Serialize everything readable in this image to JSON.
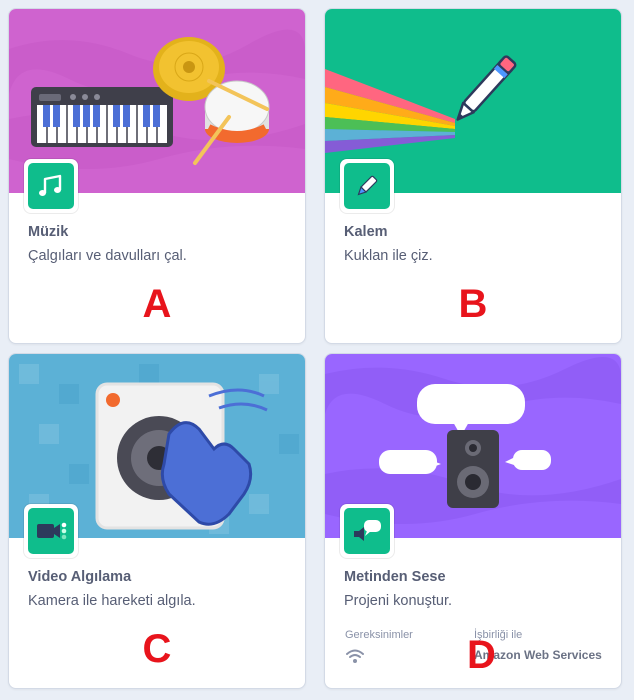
{
  "cards": [
    {
      "title": "Müzik",
      "description": "Çalgıları ve davulları çal.",
      "letter": "A",
      "badge_icon": "music-notes-icon",
      "art_color": "#cf63cf"
    },
    {
      "title": "Kalem",
      "description": "Kuklan ile çiz.",
      "letter": "B",
      "badge_icon": "pen-icon",
      "art_color": "#0fbd8c"
    },
    {
      "title": "Video Algılama",
      "description": "Kamera ile hareketi algıla.",
      "letter": "C",
      "badge_icon": "video-sensing-icon",
      "art_color": "#5cb1d6"
    },
    {
      "title": "Metinden Sese",
      "description": "Projeni konuştur.",
      "letter": "D",
      "badge_icon": "speech-bubble-icon",
      "art_color": "#9966ff",
      "requirements_label": "Gereksinimler",
      "requirements_icon": "wifi-icon",
      "collaboration_label": "İşbirliği ile",
      "collaborator": "Amazon Web Services"
    }
  ]
}
